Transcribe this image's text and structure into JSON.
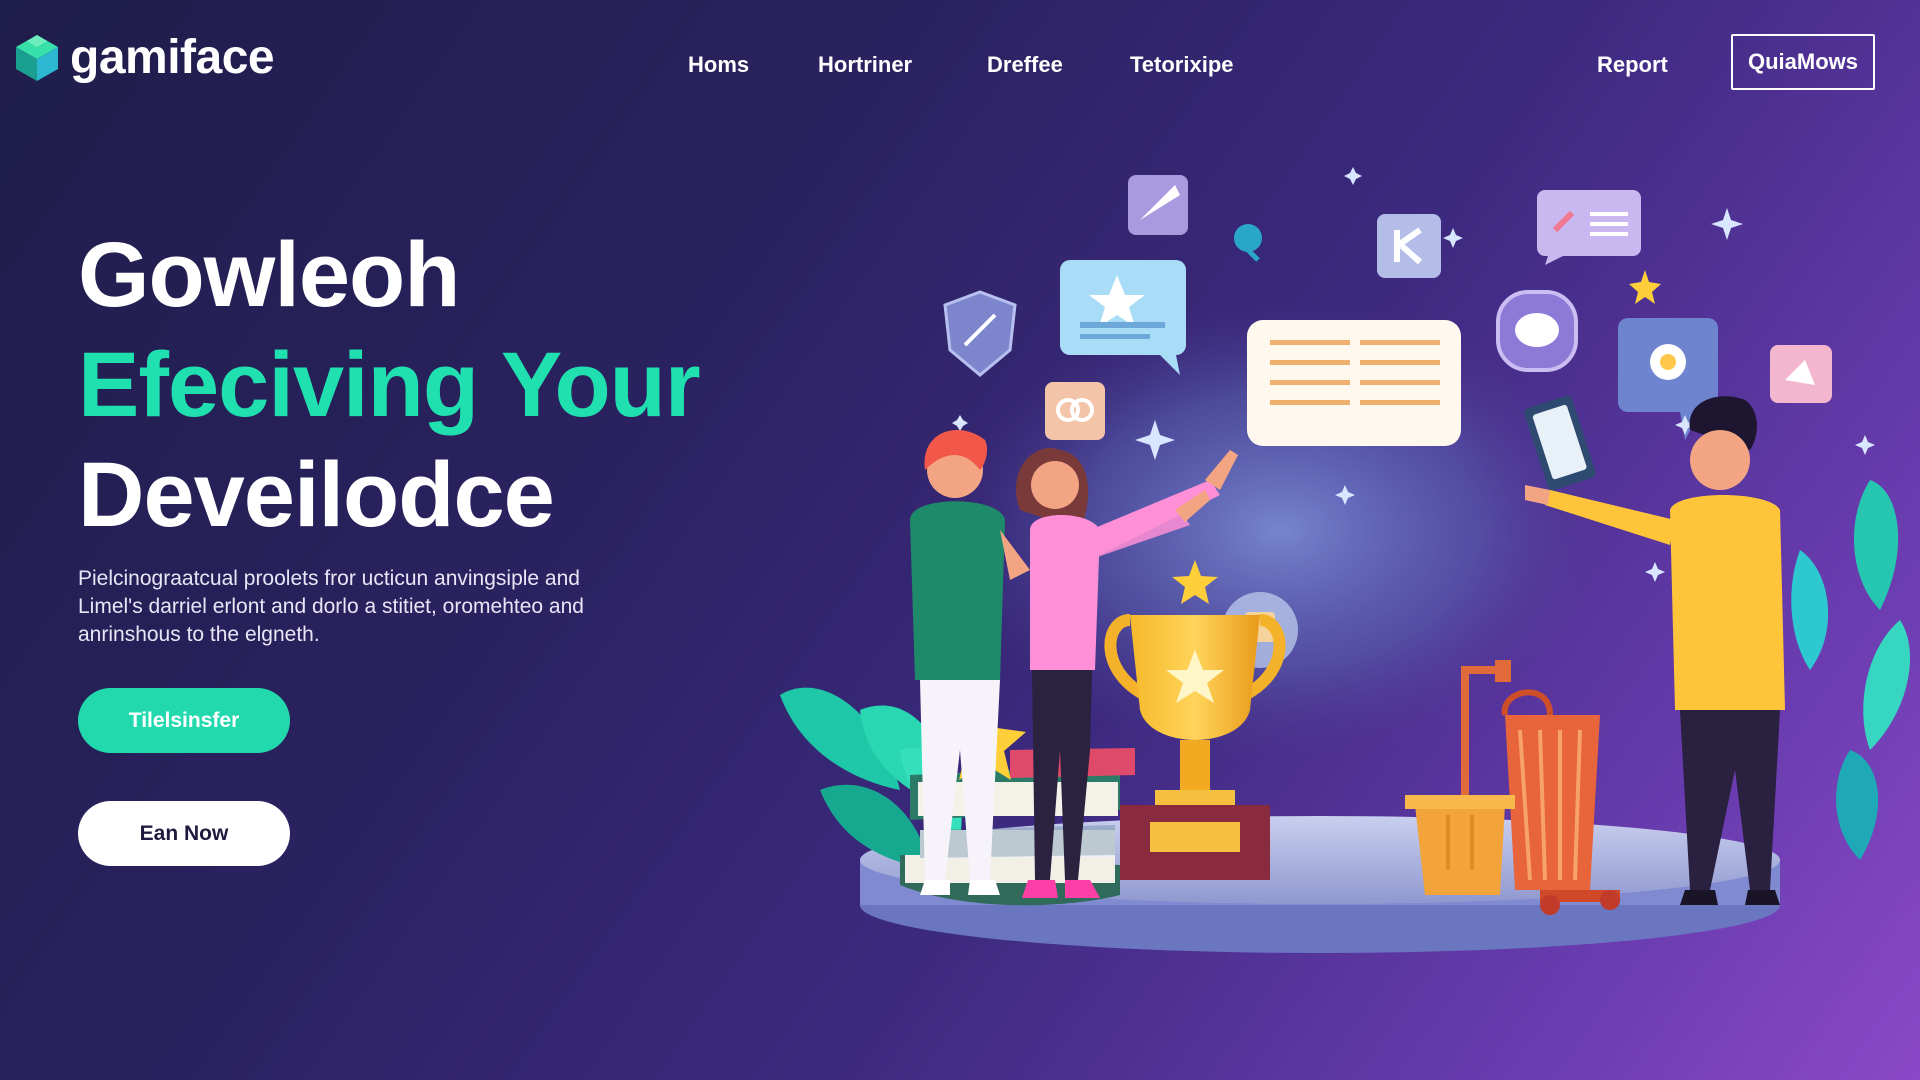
{
  "header": {
    "logo_text": "gamiface",
    "nav_items": [
      "Homs",
      "Hortriner",
      "Dreffee",
      "Tetorixipe"
    ],
    "report_label": "Report",
    "cta_label": "QuiaMows"
  },
  "hero": {
    "title_line1": "Gowleoh",
    "title_line2": "Efeciving Your",
    "title_line3": "Deveilodce",
    "description_line1": "Pielcinograatcual proolets fror ucticun anvingsiple and",
    "description_line2": "Limel's darriel erlont and dorlo a stitiet, oromehteo and",
    "description_line3": "anrinshous to the elgneth.",
    "primary_button": "Tilelsinsfer",
    "secondary_button": "Ean Now"
  },
  "colors": {
    "accent": "#21d9ad",
    "background_start": "#1f1d4a",
    "background_end": "#8a49c6"
  },
  "icons": [
    "logo-cube-icon",
    "shield-icon",
    "star-chat-icon",
    "quill-icon",
    "list-card-icon",
    "trophy-icon",
    "medal-icon",
    "flower-chat-icon",
    "book-stack-icon",
    "tablet-icon"
  ]
}
